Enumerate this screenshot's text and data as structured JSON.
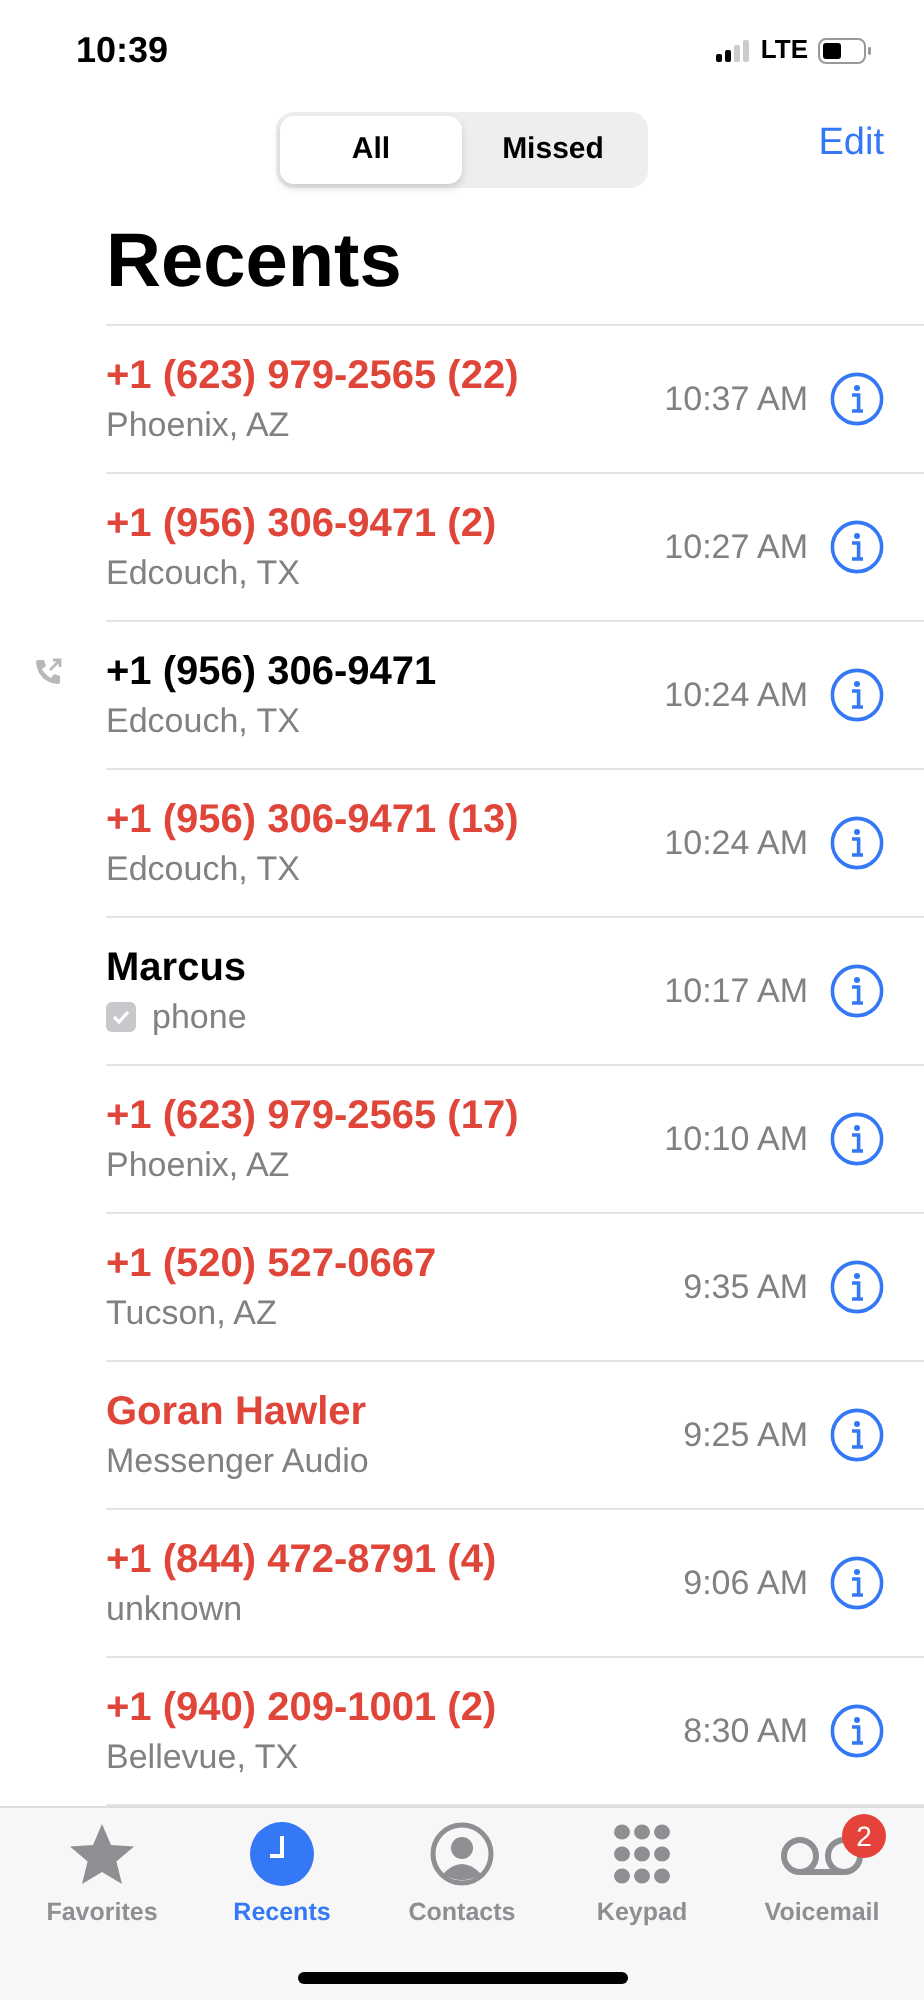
{
  "status_bar": {
    "time": "10:39",
    "network": "LTE"
  },
  "segments": [
    {
      "label": "All",
      "selected": true
    },
    {
      "label": "Missed",
      "selected": false
    }
  ],
  "edit_button": "Edit",
  "title": "Recents",
  "calls": [
    {
      "name": "+1 (623) 979-2565 (22)",
      "subtitle": "Phoenix, AZ",
      "time": "10:37 AM",
      "missed": true,
      "outgoing": false,
      "contact_label": false
    },
    {
      "name": "+1 (956) 306-9471 (2)",
      "subtitle": "Edcouch, TX",
      "time": "10:27 AM",
      "missed": true,
      "outgoing": false,
      "contact_label": false
    },
    {
      "name": "+1 (956) 306-9471",
      "subtitle": "Edcouch, TX",
      "time": "10:24 AM",
      "missed": false,
      "outgoing": true,
      "contact_label": false
    },
    {
      "name": "+1 (956) 306-9471 (13)",
      "subtitle": "Edcouch, TX",
      "time": "10:24 AM",
      "missed": true,
      "outgoing": false,
      "contact_label": false
    },
    {
      "name": "Marcus",
      "subtitle": "phone",
      "time": "10:17 AM",
      "missed": false,
      "outgoing": false,
      "contact_label": true
    },
    {
      "name": "+1 (623) 979-2565 (17)",
      "subtitle": "Phoenix, AZ",
      "time": "10:10 AM",
      "missed": true,
      "outgoing": false,
      "contact_label": false
    },
    {
      "name": "+1 (520) 527-0667",
      "subtitle": "Tucson, AZ",
      "time": "9:35 AM",
      "missed": true,
      "outgoing": false,
      "contact_label": false
    },
    {
      "name": "Goran Hawler",
      "subtitle": "Messenger Audio",
      "time": "9:25 AM",
      "missed": true,
      "outgoing": false,
      "contact_label": false
    },
    {
      "name": "+1 (844) 472-8791 (4)",
      "subtitle": "unknown",
      "time": "9:06 AM",
      "missed": true,
      "outgoing": false,
      "contact_label": false
    },
    {
      "name": "+1 (940) 209-1001 (2)",
      "subtitle": "Bellevue, TX",
      "time": "8:30 AM",
      "missed": true,
      "outgoing": false,
      "contact_label": false
    }
  ],
  "tab_bar": [
    {
      "kind": "star",
      "label": "Favorites",
      "selected": false
    },
    {
      "kind": "clock",
      "label": "Recents",
      "selected": true
    },
    {
      "kind": "person",
      "label": "Contacts",
      "selected": false
    },
    {
      "kind": "keypad",
      "label": "Keypad",
      "selected": false
    },
    {
      "kind": "voicemail",
      "label": "Voicemail",
      "selected": false,
      "badge": "2"
    }
  ]
}
